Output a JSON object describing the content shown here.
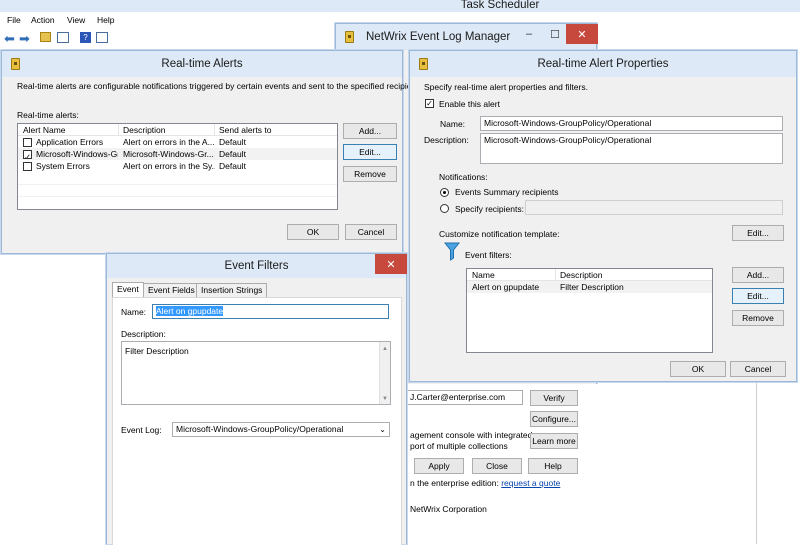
{
  "task_scheduler": {
    "title": "Task Scheduler",
    "menu": [
      "File",
      "Action",
      "View",
      "Help"
    ]
  },
  "netwrix": {
    "title": "NetWrix Event Log Manager",
    "email_value": "J.Carter@enterprise.com",
    "verify_label": "Verify",
    "configure_label": "Configure...",
    "management_text_1": "agement console with integrated",
    "management_text_2": "port of multiple collections",
    "learn_more_label": "Learn more",
    "apply_label": "Apply",
    "close_label": "Close",
    "help_label": "Help",
    "enterprise_text": "n the enterprise edition:",
    "request_quote_label": "request a quote",
    "copyright_text": "NetWrix Corporation"
  },
  "realtime_alerts": {
    "title": "Real-time Alerts",
    "description": "Real-time alerts are configurable notifications triggered by certain events and sent to the specified recipients.",
    "list_label": "Real-time alerts:",
    "columns": [
      "Alert Name",
      "Description",
      "Send alerts to"
    ],
    "rows": [
      {
        "checked": false,
        "name": "Application Errors",
        "description": "Alert on errors in the A...",
        "send_to": "Default"
      },
      {
        "checked": true,
        "name": "Microsoft-Windows-Gr...",
        "description": "Microsoft-Windows-Gr...",
        "send_to": "Default"
      },
      {
        "checked": false,
        "name": "System Errors",
        "description": "Alert on errors in the Sy...",
        "send_to": "Default"
      }
    ],
    "add_label": "Add...",
    "edit_label": "Edit...",
    "remove_label": "Remove",
    "ok_label": "OK",
    "cancel_label": "Cancel"
  },
  "alert_properties": {
    "title": "Real-time Alert Properties",
    "description": "Specify real-time alert properties and filters.",
    "enable_label": "Enable this alert",
    "enable_checked": true,
    "name_label": "Name:",
    "name_value": "Microsoft-Windows-GroupPolicy/Operational",
    "description_label": "Description:",
    "description_value": "Microsoft-Windows-GroupPolicy/Operational",
    "notifications_label": "Notifications:",
    "summary_recipients_label": "Events Summary recipients",
    "specify_recipients_label": "Specify recipients:",
    "customize_template_label": "Customize notification template:",
    "template_edit_label": "Edit...",
    "event_filters_label": "Event filters:",
    "filter_columns": [
      "Name",
      "Description"
    ],
    "filter_rows": [
      {
        "name": "Alert on gpupdate",
        "description": "Filter Description"
      }
    ],
    "add_label": "Add...",
    "edit_label": "Edit...",
    "remove_label": "Remove",
    "ok_label": "OK",
    "cancel_label": "Cancel"
  },
  "event_filters": {
    "title": "Event Filters",
    "tabs": [
      "Event",
      "Event Fields",
      "Insertion Strings"
    ],
    "name_label": "Name:",
    "name_value": "Alert on gpupdate",
    "description_label": "Description:",
    "description_value": "Filter Description",
    "event_log_label": "Event Log:",
    "event_log_value": "Microsoft-Windows-GroupPolicy/Operational"
  },
  "colors": {
    "title_bar": "#dde9f6",
    "close_button": "#c7483c",
    "selection": "#3399ff",
    "link": "#0645ad"
  }
}
